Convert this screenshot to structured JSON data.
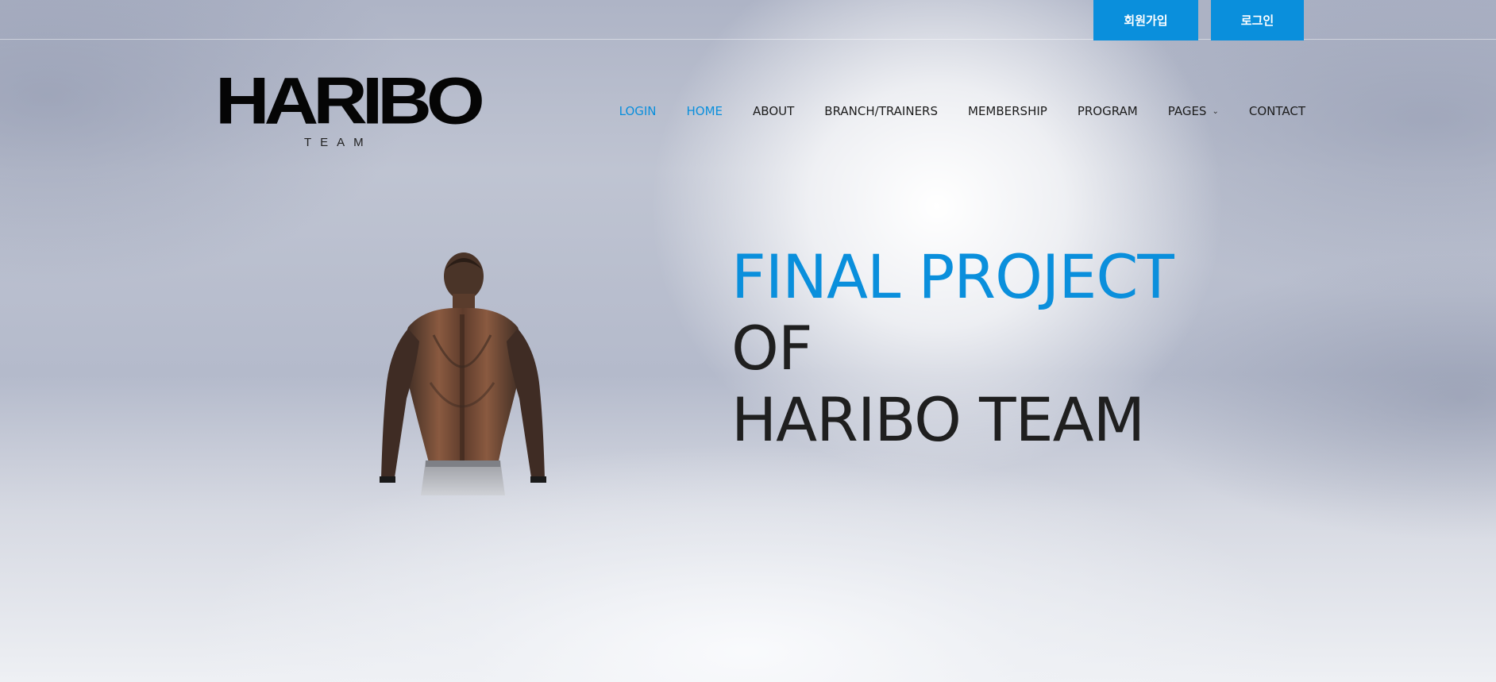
{
  "topbar": {
    "signup_label": "회원가입",
    "login_label": "로그인"
  },
  "logo": {
    "main": "HARIBO",
    "sub": "TEAM"
  },
  "nav": {
    "items": [
      {
        "label": "LOGIN",
        "active": true
      },
      {
        "label": "HOME",
        "active": true
      },
      {
        "label": "ABOUT",
        "active": false
      },
      {
        "label": "BRANCH/TRAINERS",
        "active": false
      },
      {
        "label": "MEMBERSHIP",
        "active": false
      },
      {
        "label": "PROGRAM",
        "active": false
      },
      {
        "label": "PAGES",
        "active": false,
        "has_dropdown": true
      },
      {
        "label": "CONTACT",
        "active": false
      }
    ]
  },
  "hero": {
    "line1": "FINAL PROJECT",
    "line2": "OF",
    "line3": "HARIBO TEAM"
  },
  "colors": {
    "accent": "#0a8fdc",
    "text": "#1f1f1f"
  }
}
